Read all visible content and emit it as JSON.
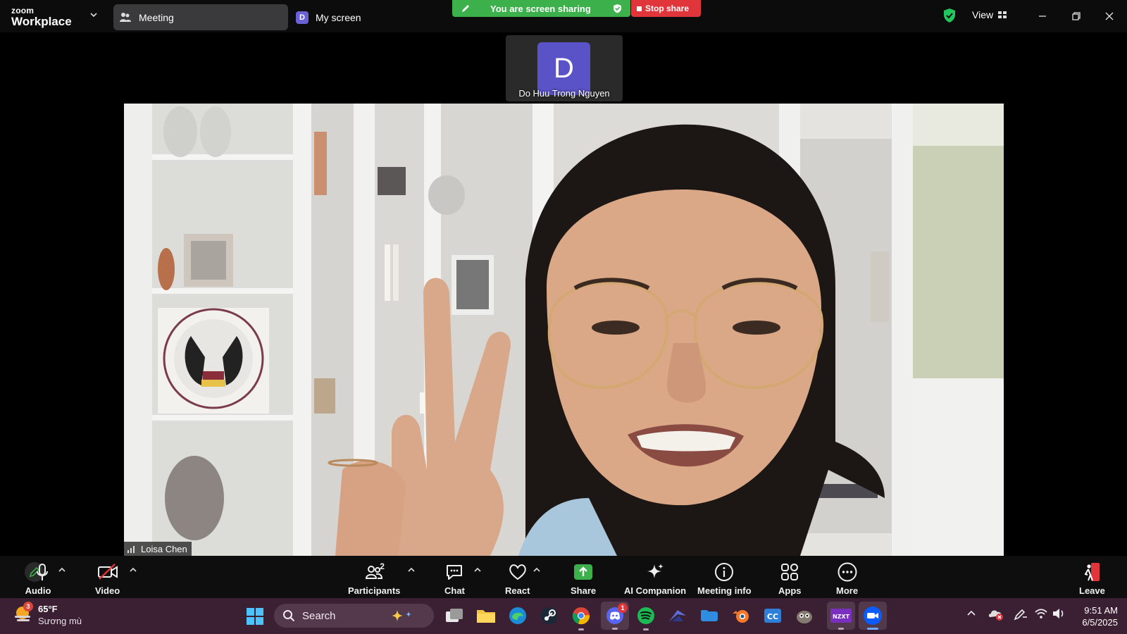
{
  "titlebar": {
    "logo_top": "zoom",
    "logo_bottom": "Workplace",
    "tabs": [
      {
        "label": "Meeting"
      },
      {
        "label": "My screen",
        "badge": "D"
      }
    ],
    "share_status": "You are screen sharing",
    "stop_share": "Stop share",
    "view_label": "View"
  },
  "thumbnail": {
    "initial": "D",
    "name": "Do Huu Trong Nguyen",
    "avatar_color": "#5a52c7"
  },
  "video": {
    "participant_name": "Loisa Chen"
  },
  "toolbar": {
    "items": [
      {
        "label": "Audio",
        "icon": "microphone-icon"
      },
      {
        "label": "Video",
        "icon": "video-off-icon"
      },
      {
        "label": "Participants",
        "icon": "participants-icon",
        "count": "2"
      },
      {
        "label": "Chat",
        "icon": "chat-icon"
      },
      {
        "label": "React",
        "icon": "heart-icon"
      },
      {
        "label": "Share",
        "icon": "share-screen-icon"
      },
      {
        "label": "AI Companion",
        "icon": "sparkle-icon"
      },
      {
        "label": "Meeting info",
        "icon": "info-icon"
      },
      {
        "label": "Apps",
        "icon": "apps-icon"
      },
      {
        "label": "More",
        "icon": "more-icon"
      },
      {
        "label": "Leave",
        "icon": "leave-icon"
      }
    ]
  },
  "taskbar": {
    "weather": {
      "temp": "65°F",
      "condition": "Sương mù",
      "badge": "3"
    },
    "search_placeholder": "Search",
    "apps": [
      "task-view",
      "file-explorer",
      "edge",
      "steam",
      "chrome",
      "discord",
      "spotify",
      "app-wing",
      "app-folder",
      "blender",
      "cc-app",
      "gimp",
      "nzxt",
      "zoom"
    ],
    "discord_badge": "1",
    "time": "9:51 AM",
    "date": "6/5/2025"
  },
  "colors": {
    "share_green": "#3cb04a",
    "stop_red": "#e1353c",
    "taskbar_bg": "#3b1f33",
    "security_green": "#22c55e"
  }
}
